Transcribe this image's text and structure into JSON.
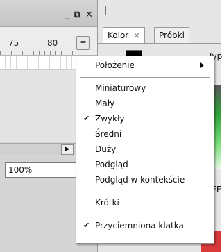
{
  "timeline": {
    "window_controls": {
      "minimize": "_",
      "restore": "⧉",
      "close": "✕"
    },
    "ruler_labels": [
      "75",
      "80"
    ],
    "panel_menu_icon": "≡",
    "scroll_right_icon": "▶",
    "zoom_value": "100%"
  },
  "color_panel": {
    "tabs": [
      {
        "label": "Kolor",
        "close": "×",
        "active": true
      },
      {
        "label": "Próbki",
        "active": false
      }
    ],
    "partial_type_label": "Typ:",
    "partial_hex_label": "FF",
    "swatch_color": "#000000"
  },
  "context_menu": {
    "items": [
      {
        "label": "Położenie",
        "checked": false,
        "submenu": true
      },
      {
        "separator": true
      },
      {
        "label": "Miniaturowy",
        "checked": false
      },
      {
        "label": "Mały",
        "checked": false
      },
      {
        "label": "Zwykły",
        "checked": true
      },
      {
        "label": "Średni",
        "checked": false
      },
      {
        "label": "Duży",
        "checked": false
      },
      {
        "label": "Podgląd",
        "checked": false
      },
      {
        "label": "Podgląd w kontekście",
        "checked": false
      },
      {
        "separator": true
      },
      {
        "label": "Krótki",
        "checked": false
      },
      {
        "separator": true
      },
      {
        "label": "Przyciemniona klatka",
        "checked": true
      }
    ],
    "check_glyph": "✔"
  },
  "colors": {
    "menu_background": "#ffffff",
    "panel_background": "#d5d5d5",
    "accent_red": "#d83a3a",
    "accent_green": "#2fa23a"
  }
}
